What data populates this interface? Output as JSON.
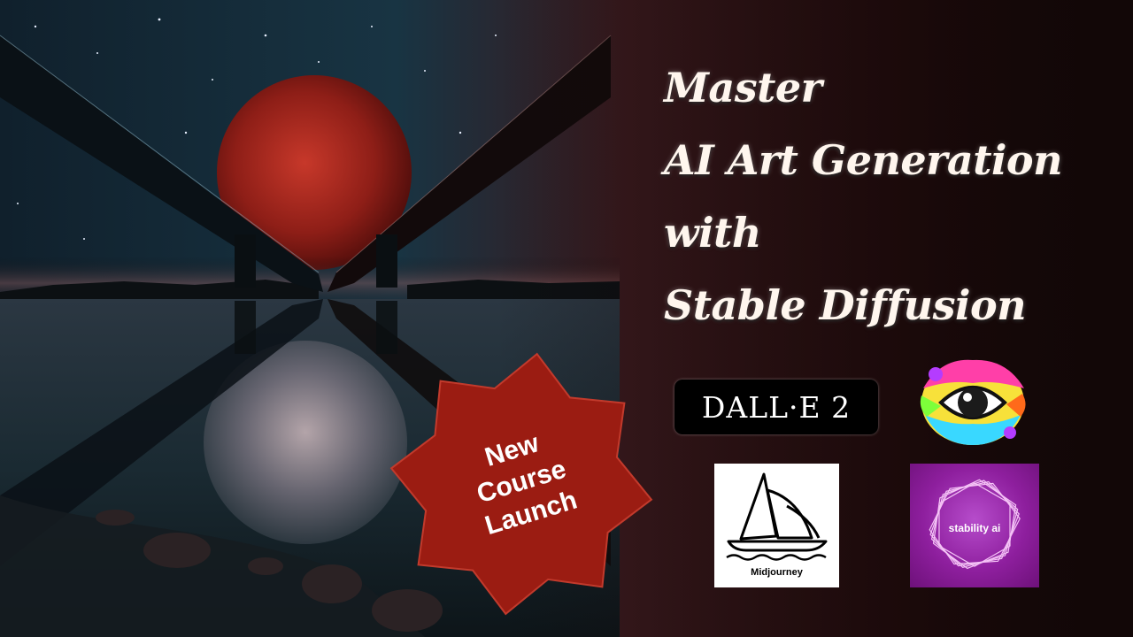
{
  "headline": {
    "line1": "Master",
    "line2": "AI Art Generation",
    "line3": "with",
    "line4": "Stable Diffusion"
  },
  "badge": {
    "line1": "New",
    "line2": "Course",
    "line3": "Launch",
    "color": "#9b1c12"
  },
  "logos": {
    "dalle": "DALL·E  2",
    "midjourney": "Midjourney",
    "stability": "stability ai"
  },
  "colors": {
    "headline": "#fff6ee",
    "stability_purple": "#8e1f9e",
    "moon_red": "#a3241c"
  }
}
